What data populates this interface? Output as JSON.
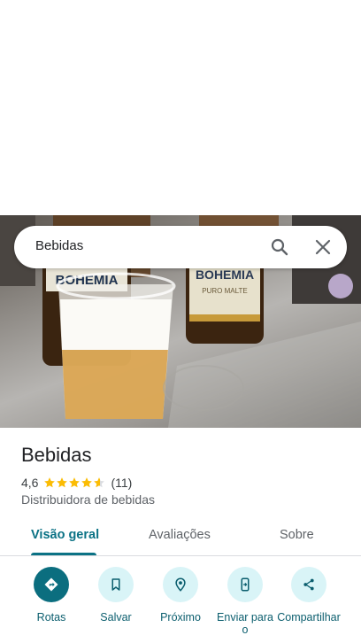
{
  "search": {
    "query": "Bebidas"
  },
  "place": {
    "name": "Bebidas",
    "rating": "4,6",
    "stars": 4.6,
    "review_count": "(11)",
    "category": "Distribuidora de bebidas"
  },
  "tabs": [
    {
      "label": "Visão geral",
      "active": true
    },
    {
      "label": "Avaliações",
      "active": false
    },
    {
      "label": "Sobre",
      "active": false
    }
  ],
  "actions": [
    {
      "label": "Rotas",
      "icon": "directions-icon"
    },
    {
      "label": "Salvar",
      "icon": "bookmark-icon"
    },
    {
      "label": "Próximo",
      "icon": "nearby-icon"
    },
    {
      "label": "Enviar para o",
      "icon": "send-to-phone-icon"
    },
    {
      "label": "Compartilhar",
      "icon": "share-icon"
    }
  ],
  "photo": {
    "bottle_label_text": "BOHEMIA",
    "bottle_sub_text": "PURO MALTE"
  },
  "colors": {
    "accent": "#0b7285",
    "action_bg": "#d9f4f7",
    "star": "#fbbc04"
  }
}
